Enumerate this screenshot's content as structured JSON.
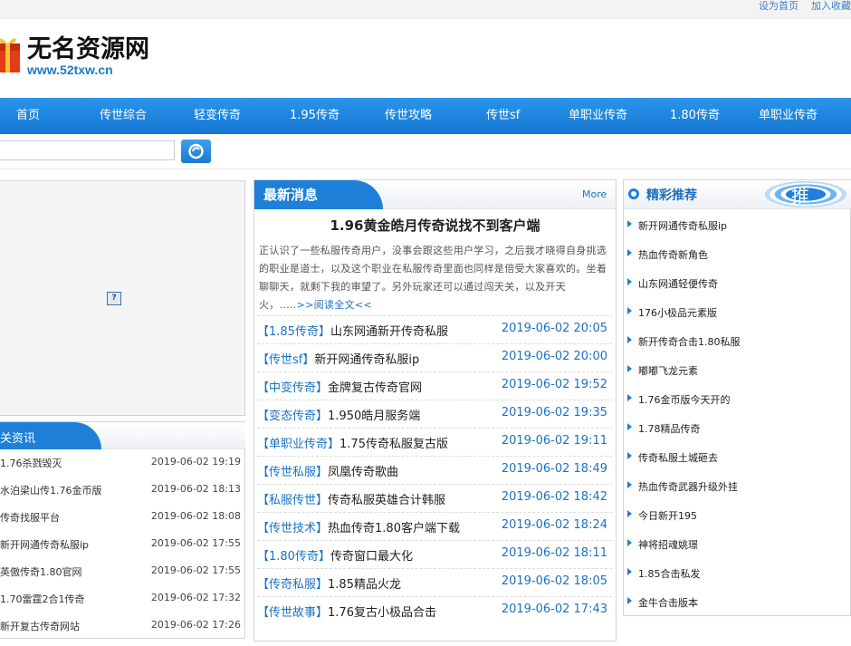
{
  "top_links": [
    "设为首页",
    "加入收藏"
  ],
  "logo": {
    "title": "无名资源网",
    "url_text": "www.52txw.cn",
    "icon": "gift-box-icon"
  },
  "nav": [
    "首页",
    "传世综合",
    "轻变传奇",
    "1.95传奇",
    "传世攻略",
    "传世sf",
    "单职业传奇",
    "1.80传奇",
    "单职业传奇"
  ],
  "search": {
    "value": "",
    "button_icon": "search-icon"
  },
  "banner": {
    "icon": "broken-image-icon",
    "glyph": "?"
  },
  "left_news": {
    "title": "关资讯",
    "items": [
      {
        "title": "1.76杀戮毁灭",
        "date": "2019-06-02 19:19"
      },
      {
        "title": "水泊梁山传1.76金币版",
        "date": "2019-06-02 18:13"
      },
      {
        "title": "传奇找服平台",
        "date": "2019-06-02 18:08"
      },
      {
        "title": "新开网通传奇私服ip",
        "date": "2019-06-02 17:55"
      },
      {
        "title": "英傲传奇1.80官网",
        "date": "2019-06-02 17:55"
      },
      {
        "title": "1.70雷霆2合1传奇",
        "date": "2019-06-02 17:32"
      },
      {
        "title": "新开复古传奇网站",
        "date": "2019-06-02 17:26"
      }
    ]
  },
  "latest": {
    "title": "最新消息",
    "more": "More",
    "headline": "1.96黄金皓月传奇说找不到客户端",
    "summary": "正认识了一些私服传奇用户，没事会跟这些用户学习，之后我才晓得自身挑选的职业是道士，以及这个职业在私服传奇里面也同样是倍受大家喜欢的。坐着聊聊天，就剩下我的审望了。另外玩家还可以通过闯天关，以及开天火，.....",
    "read_more": ">>阅读全文<<",
    "items": [
      {
        "cat": "【1.85传奇】",
        "title": "山东网通新开传奇私服",
        "date": "2019-06-02 20:05"
      },
      {
        "cat": "【传世sf】",
        "title": "新开网通传奇私服ip",
        "date": "2019-06-02 20:00"
      },
      {
        "cat": "【中变传奇】",
        "title": "金牌复古传奇官网",
        "date": "2019-06-02 19:52"
      },
      {
        "cat": "【变态传奇】",
        "title": "1.950皓月服务端",
        "date": "2019-06-02 19:35"
      },
      {
        "cat": "【单职业传奇】",
        "title": "1.75传奇私服复古版",
        "date": "2019-06-02 19:11"
      },
      {
        "cat": "【传世私服】",
        "title": "凤凰传奇歌曲",
        "date": "2019-06-02 18:49"
      },
      {
        "cat": "【私服传世】",
        "title": "传奇私服英雄合计韩服",
        "date": "2019-06-02 18:42"
      },
      {
        "cat": "【传世技术】",
        "title": "热血传奇1.80客户端下载",
        "date": "2019-06-02 18:24"
      },
      {
        "cat": "【1.80传奇】",
        "title": "传奇窗口最大化",
        "date": "2019-06-02 18:11"
      },
      {
        "cat": "【传奇私服】",
        "title": "1.85精品火龙",
        "date": "2019-06-02 18:05"
      },
      {
        "cat": "【传世故事】",
        "title": "1.76复古小极品合击",
        "date": "2019-06-02 17:43"
      }
    ]
  },
  "featured": {
    "title": "精彩推荐",
    "badge": "推",
    "items": [
      "新开网通传奇私服ip",
      "热血传奇新角色",
      "山东网通轻便传奇",
      "176小极品元素版",
      "新开传奇合击1.80私服",
      "嘟嘟飞龙元素",
      "1.76金币版今天开的",
      "1.78精品传奇",
      "传奇私服土城砸去",
      "热血传奇武器升级外挂",
      "今日新开195",
      "神将招魂姚璟",
      "1.85合击私发",
      "金牛合击版本"
    ]
  },
  "colors": {
    "nav_blue": "#1d7fd8",
    "link_blue": "#1b72c4"
  }
}
